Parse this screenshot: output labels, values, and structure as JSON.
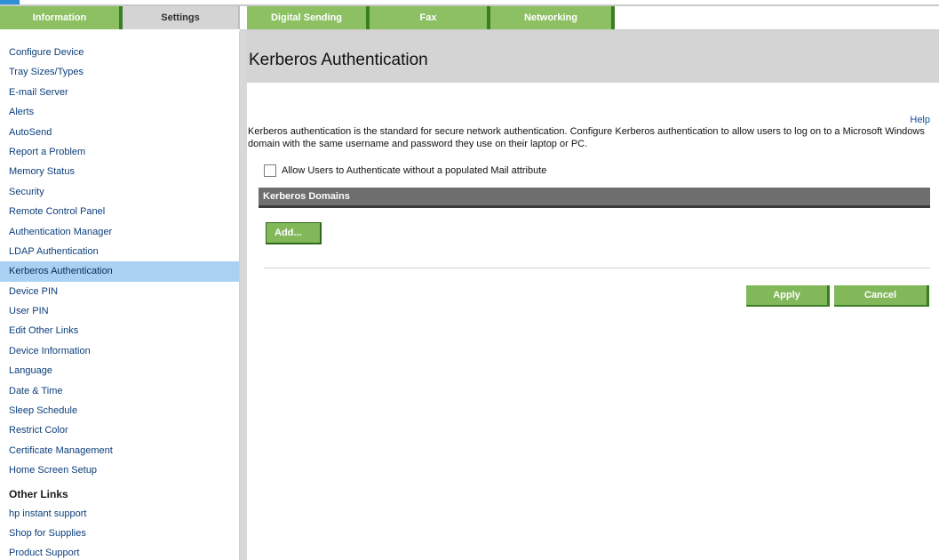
{
  "tabs": [
    "Information",
    "Settings",
    "Digital Sending",
    "Fax",
    "Networking"
  ],
  "active_tab": "Settings",
  "sidebar": {
    "items": [
      "Configure Device",
      "Tray Sizes/Types",
      "E-mail Server",
      "Alerts",
      "AutoSend",
      "Report a Problem",
      "Memory Status",
      "Security",
      "Remote Control Panel",
      "Authentication Manager",
      "LDAP Authentication",
      "Kerberos Authentication",
      "Device PIN",
      "User PIN",
      "Edit Other Links",
      "Device Information",
      "Language",
      "Date & Time",
      "Sleep Schedule",
      "Restrict Color",
      "Certificate Management",
      "Home Screen Setup"
    ],
    "active_item": "Kerberos Authentication",
    "other_links_heading": "Other Links",
    "other_links": [
      "hp instant support",
      "Shop for Supplies",
      "Product Support"
    ]
  },
  "main": {
    "title": "Kerberos Authentication",
    "help": "Help",
    "description": "Kerberos authentication is the standard for secure network authentication. Configure Kerberos authentication to allow users to log on to a Microsoft Windows domain with the same username and password they use on their laptop or PC.",
    "checkbox_label": "Allow Users to Authenticate without a populated Mail attribute",
    "checkbox_checked": false,
    "section_title": "Kerberos Domains",
    "add_button": "Add...",
    "apply_button": "Apply",
    "cancel_button": "Cancel"
  },
  "colors": {
    "tab_green": "#8cc063",
    "tab_active": "#d4d4d4",
    "sidebar_active": "#a9d1f2",
    "section_header": "#6e6e6e",
    "button_green": "#82b85a"
  }
}
